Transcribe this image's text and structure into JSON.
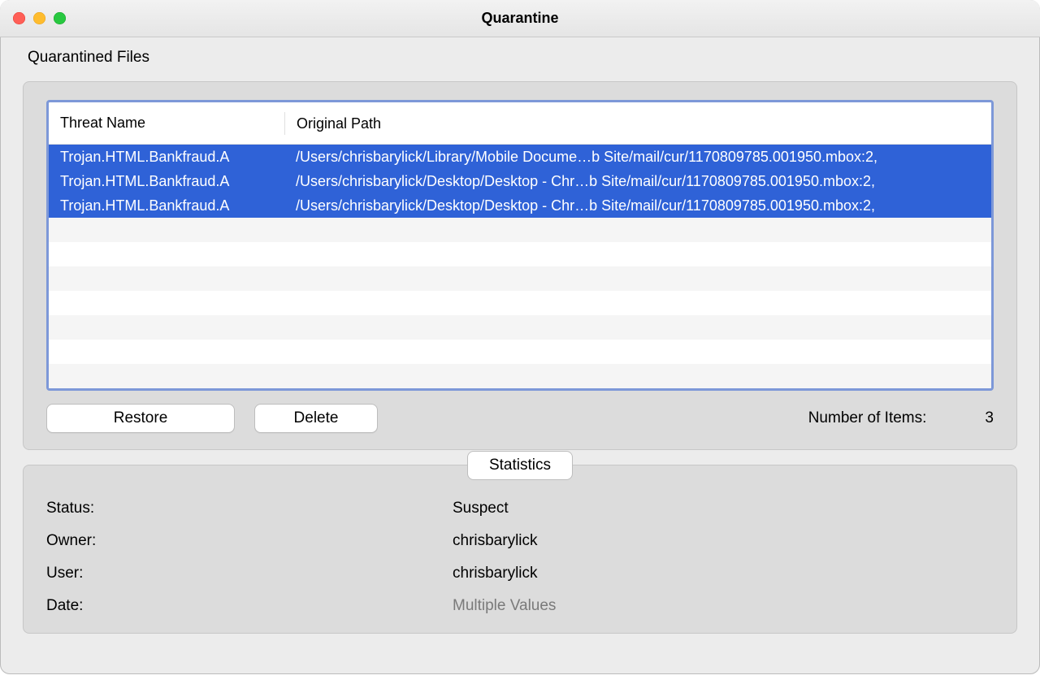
{
  "window": {
    "title": "Quarantine"
  },
  "quarantine": {
    "section_label": "Quarantined Files",
    "columns": {
      "threat": "Threat Name",
      "path": "Original Path"
    },
    "rows": [
      {
        "threat": "Trojan.HTML.Bankfraud.A",
        "path": "/Users/chrisbarylick/Library/Mobile Docume…b Site/mail/cur/1170809785.001950.mbox:2,",
        "selected": true
      },
      {
        "threat": "Trojan.HTML.Bankfraud.A",
        "path": "/Users/chrisbarylick/Desktop/Desktop - Chr…b Site/mail/cur/1170809785.001950.mbox:2,",
        "selected": true
      },
      {
        "threat": "Trojan.HTML.Bankfraud.A",
        "path": "/Users/chrisbarylick/Desktop/Desktop - Chr…b Site/mail/cur/1170809785.001950.mbox:2,",
        "selected": true
      }
    ],
    "filler_rows": 7,
    "buttons": {
      "restore": "Restore",
      "delete": "Delete"
    },
    "count_label": "Number of Items:",
    "count_value": "3"
  },
  "stats": {
    "tab_label": "Statistics",
    "fields": [
      {
        "label": "Status:",
        "value": "Suspect",
        "muted": false
      },
      {
        "label": "Owner:",
        "value": "chrisbarylick",
        "muted": false
      },
      {
        "label": "User:",
        "value": "chrisbarylick",
        "muted": false
      },
      {
        "label": "Date:",
        "value": "Multiple Values",
        "muted": true
      }
    ]
  }
}
